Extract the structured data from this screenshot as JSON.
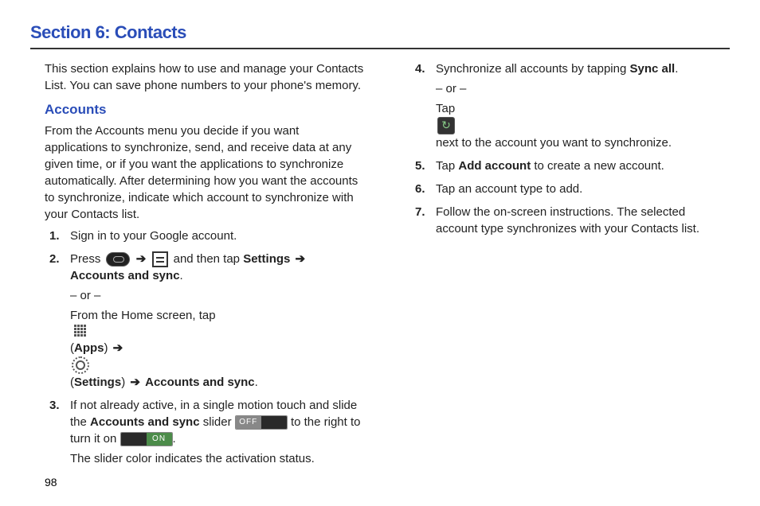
{
  "section_title": "Section 6: Contacts",
  "intro": "This section explains how to use and manage your Contacts List. You can save phone numbers to your phone's memory.",
  "subheading": "Accounts",
  "accounts_intro": "From the Accounts menu you decide if you want applications to synchronize, send, and receive data at any given time, or if you want the applications to synchronize automatically. After determining how you want the accounts to synchronize, indicate which account to synchronize with your Contacts list.",
  "steps_left": {
    "s1_num": "1.",
    "s1": "Sign in to your Google account.",
    "s2_num": "2.",
    "s2_a": "Press ",
    "s2_b": " and then tap ",
    "s2_settings": "Settings",
    "s2_arrow": "➔",
    "s2_acssync": "Accounts and sync",
    "s2_or": "– or –",
    "s2_alt_a": "From the Home screen, tap ",
    "s2_apps": "Apps",
    "s2_settings2": "Settings",
    "s2_acssync2": "Accounts and sync",
    "s3_num": "3.",
    "s3_a": "If not already active, in a single motion touch and slide the ",
    "s3_acssync": "Accounts and sync",
    "s3_b": " slider ",
    "s3_c": " to the right to turn it on ",
    "s3_d": "The slider color indicates the activation status."
  },
  "slider": {
    "off": "OFF",
    "on": "ON"
  },
  "steps_right": {
    "s4_num": "4.",
    "s4_a": "Synchronize all accounts by tapping ",
    "s4_syncall": "Sync all",
    "s4_or": "– or –",
    "s4_b": "Tap ",
    "s4_c": " next to the account you want to synchronize.",
    "s5_num": "5.",
    "s5_a": "Tap ",
    "s5_add": "Add account",
    "s5_b": " to create a new account.",
    "s6_num": "6.",
    "s6": "Tap an account type to add.",
    "s7_num": "7.",
    "s7": "Follow the on-screen instructions. The selected account type synchronizes with your Contacts list."
  },
  "page_number": "98"
}
